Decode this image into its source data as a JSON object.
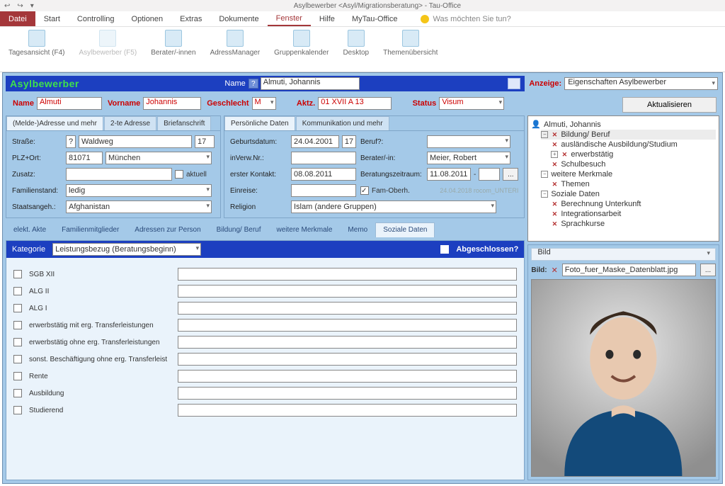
{
  "app": {
    "title": "Asylbewerber <Asyl/Migrationsberatung>  -  Tau-Office"
  },
  "ribbon": {
    "datei": "Datei",
    "tabs": [
      "Start",
      "Controlling",
      "Optionen",
      "Extras",
      "Dokumente",
      "Fenster",
      "Hilfe",
      "MyTau-Office"
    ],
    "active_tab": "Fenster",
    "search_placeholder": "Was möchten Sie tun?",
    "groups": [
      "Tagesansicht (F4)",
      "Asylbewerber (F5)",
      "Berater/-innen",
      "AdressManager",
      "Gruppenkalender",
      "Desktop",
      "Themenübersicht"
    ]
  },
  "header": {
    "brand": "Asylbewerber",
    "name_label": "Name",
    "q": "?",
    "name_value": "Almuti, Johannis"
  },
  "name_row": {
    "name_label": "Name",
    "name": "Almuti",
    "vorname_label": "Vorname",
    "vorname": "Johannis",
    "geschlecht_label": "Geschlecht",
    "geschlecht": "M",
    "aktz_label": "Aktz.",
    "aktz": "01 XVII A 13",
    "status_label": "Status",
    "status": "Visum"
  },
  "addr_tabs": [
    "(Melde-)Adresse und mehr",
    "2-te Adresse",
    "Briefanschrift"
  ],
  "addr": {
    "strasse_label": "Straße:",
    "q": "?",
    "strasse": "Waldweg",
    "hausnr": "17",
    "plzort_label": "PLZ+Ort:",
    "plz": "81071",
    "ort": "München",
    "zusatz_label": "Zusatz:",
    "zusatz": "",
    "aktuell_label": "aktuell",
    "familienstand_label": "Familienstand:",
    "familienstand": "ledig",
    "staat_label": "Staatsangeh.:",
    "staat": "Afghanistan"
  },
  "pers_tabs": [
    "Persönliche Daten",
    "Kommunikation und mehr"
  ],
  "pers": {
    "gebdat_label": "Geburtsdatum:",
    "gebdat": "24.04.2001",
    "gebdat_age": "17",
    "beruf_label": "Beruf?:",
    "beruf": "",
    "inverw_label": "inVerw.Nr.:",
    "inverw": "",
    "berater_label": "Berater/-in:",
    "berater": "Meier, Robert",
    "erster_label": "erster Kontakt:",
    "erster": "08.08.2011",
    "zeitraum_label": "Beratungszeitraum:",
    "zeitraum_von": "11.08.2011",
    "zeitraum_sep": "-",
    "zeitraum_bis": "",
    "dots": "...",
    "einreise_label": "Einreise:",
    "einreise": "",
    "famoberh_label": "Fam-Oberh.",
    "stamp": "24.04.2018 rocom_UNTERI",
    "religion_label": "Religion",
    "religion": "Islam (andere Gruppen)"
  },
  "lower_tabs": [
    "elekt. Akte",
    "Familienmitglieder",
    "Adressen zur Person",
    "Bildung/ Beruf",
    "weitere Merkmale",
    "Memo",
    "Soziale Daten"
  ],
  "kategorie": {
    "label": "Kategorie",
    "value": "Leistungsbezug (Beratungsbeginn)",
    "abgeschlossen": "Abgeschlossen?"
  },
  "check_items": [
    "SGB XII",
    "ALG II",
    "ALG I",
    "erwerbstätig mit erg. Transferleistungen",
    "erwerbstätig ohne erg. Transferleistungen",
    "sonst. Beschäftigung ohne erg. Transferleist",
    "Rente",
    "Ausbildung",
    "Studierend"
  ],
  "anzeige": {
    "label": "Anzeige:",
    "value": "Eigenschaften Asylbewerber",
    "aktualisieren": "Aktualisieren"
  },
  "tree": {
    "root": "Almuti, Johannis",
    "n1": "Bildung/ Beruf",
    "n1_children": [
      "ausländische Ausbildung/Studium",
      "erwerbstätig",
      "Schulbesuch"
    ],
    "n2": "weitere Merkmale",
    "n2_children": [
      "Themen"
    ],
    "n3": "Soziale Daten",
    "n3_children": [
      "Berechnung Unterkunft",
      "Integrationsarbeit",
      "Sprachkurse"
    ]
  },
  "bild": {
    "panel_label": "Bild",
    "field_label": "Bild:",
    "filename": "Foto_fuer_Maske_Datenblatt.jpg",
    "dots": "..."
  }
}
